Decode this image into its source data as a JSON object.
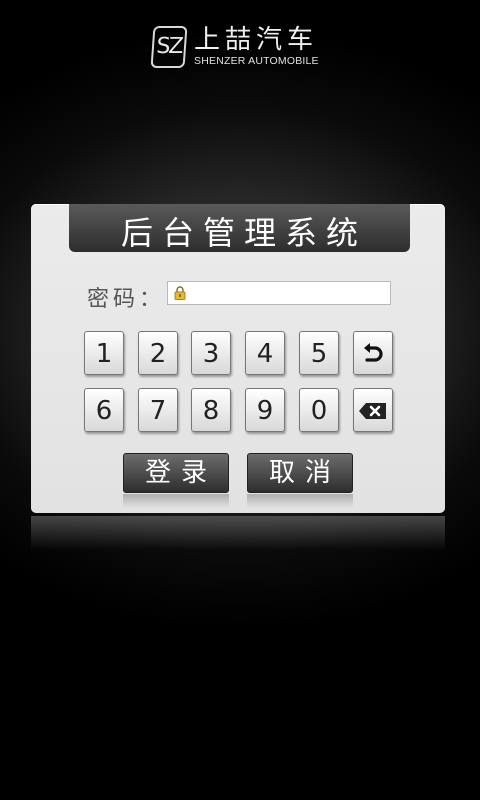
{
  "logo": {
    "mark": "SZ",
    "cn": "上喆汽车",
    "en": "SHENZER AUTOMOBILE"
  },
  "panel": {
    "title": "后台管理系统",
    "password_label": "密码：",
    "password_value": ""
  },
  "keypad": {
    "row1": [
      "1",
      "2",
      "3",
      "4",
      "5"
    ],
    "row2": [
      "6",
      "7",
      "8",
      "9",
      "0"
    ],
    "undo_icon": "undo-arrow-icon",
    "backspace_icon": "backspace-icon"
  },
  "actions": {
    "login": "登录",
    "cancel": "取消"
  }
}
